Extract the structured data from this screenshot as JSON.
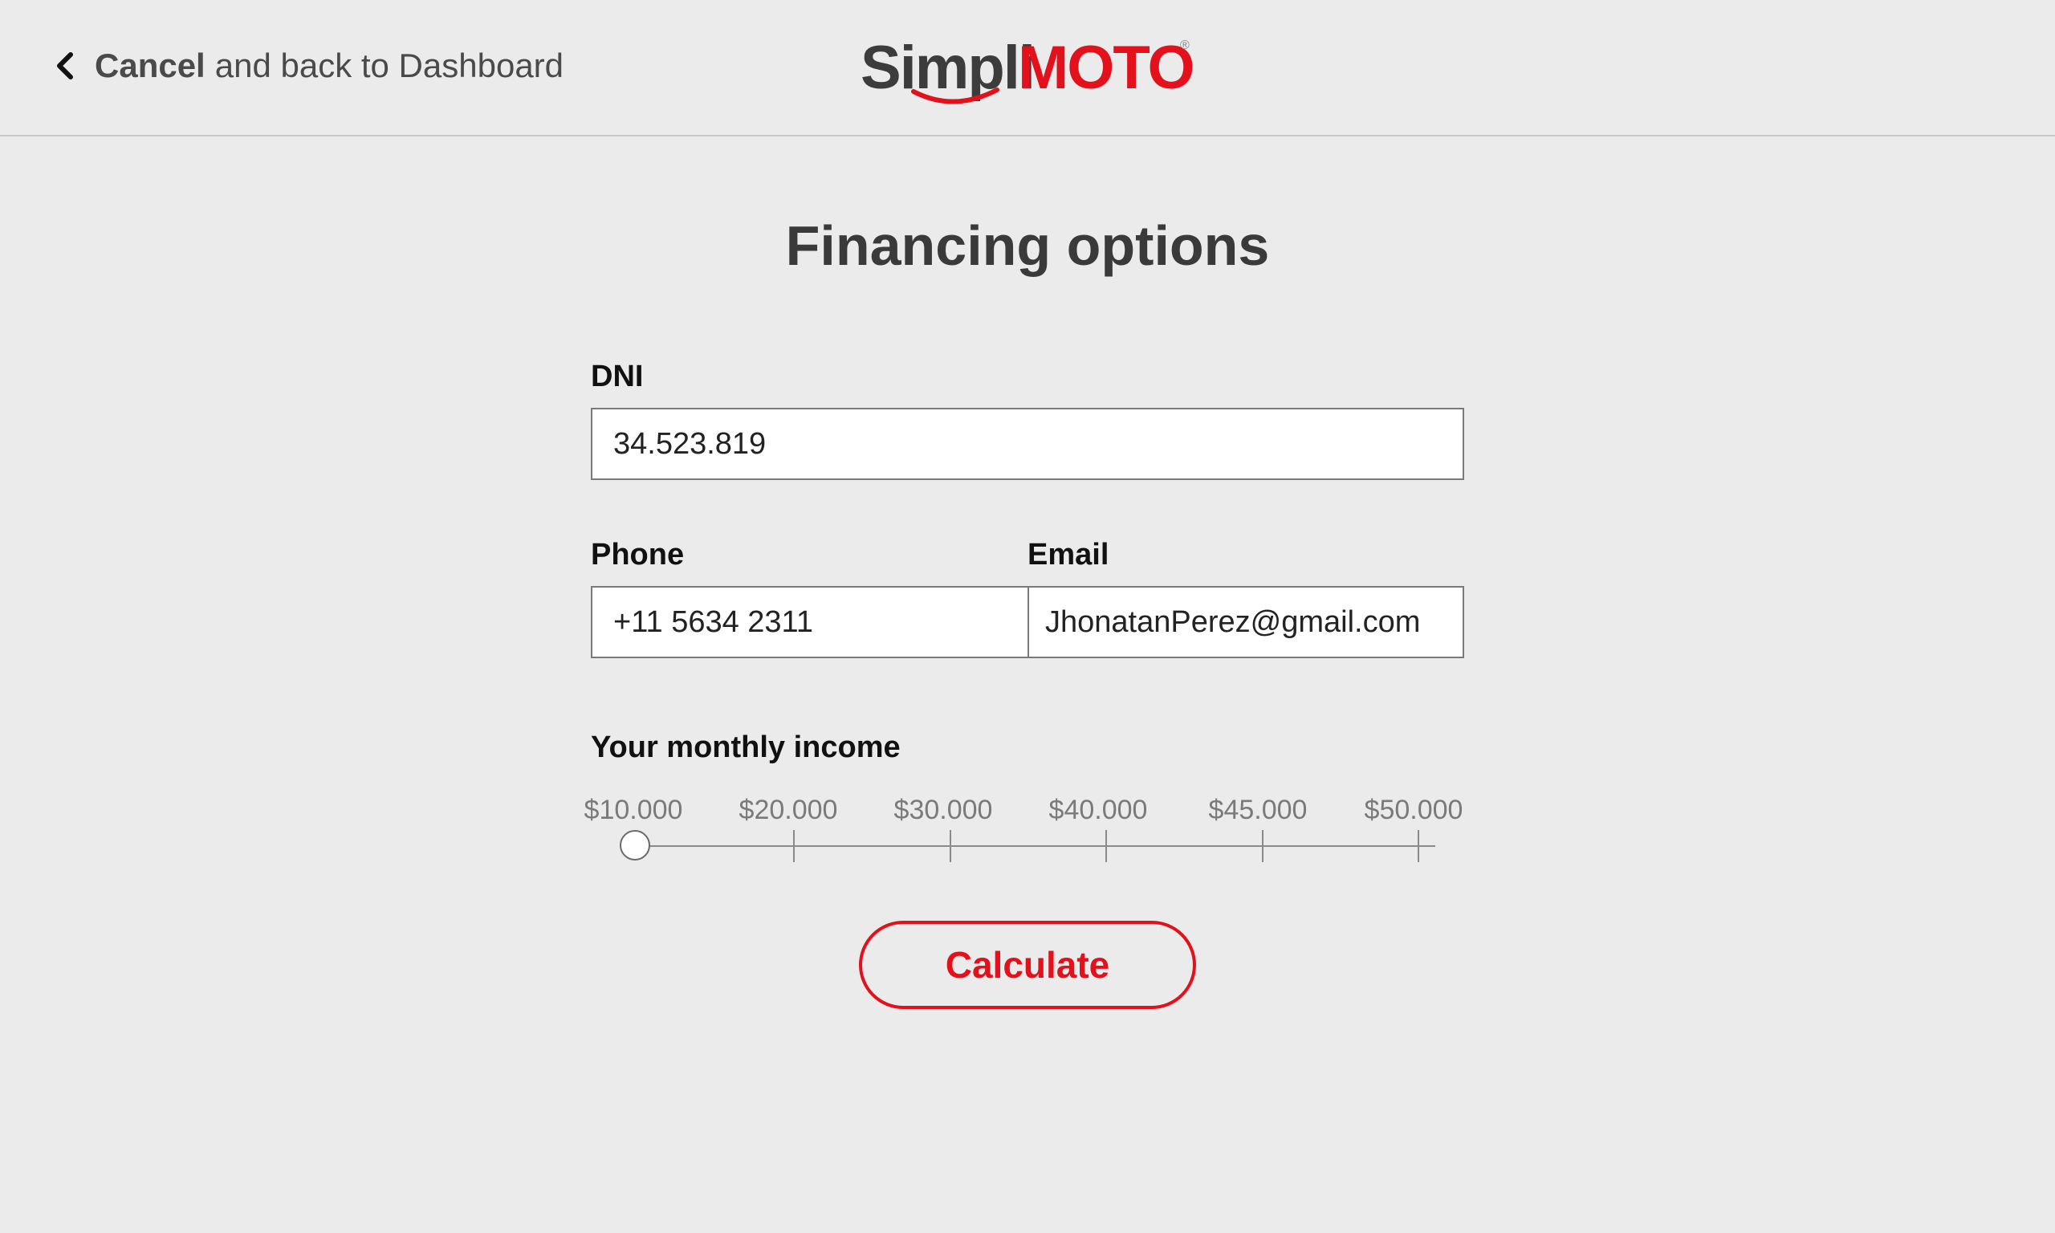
{
  "header": {
    "back_bold": "Cancel",
    "back_rest": "and back to Dashboard",
    "logo": {
      "part1": "Simpli",
      "part2": "MOTO",
      "reg_mark": "®"
    }
  },
  "page_title": "Financing options",
  "form": {
    "dni": {
      "label": "DNI",
      "value": "34.523.819"
    },
    "phone": {
      "label": "Phone",
      "value": "+11 5634 2311"
    },
    "email": {
      "label": "Email",
      "value": "JhonatanPerez@gmail.com"
    }
  },
  "income": {
    "label": "Your monthly income",
    "ticks": [
      "$10.000",
      "$20.000",
      "$30.000",
      "$40.000",
      "$45.000",
      "$50.000"
    ],
    "selected": "$10.000"
  },
  "calculate_label": "Calculate",
  "colors": {
    "brand_red": "#e3111b",
    "background": "#ebebeb",
    "text_dark": "#3a3a3a"
  }
}
